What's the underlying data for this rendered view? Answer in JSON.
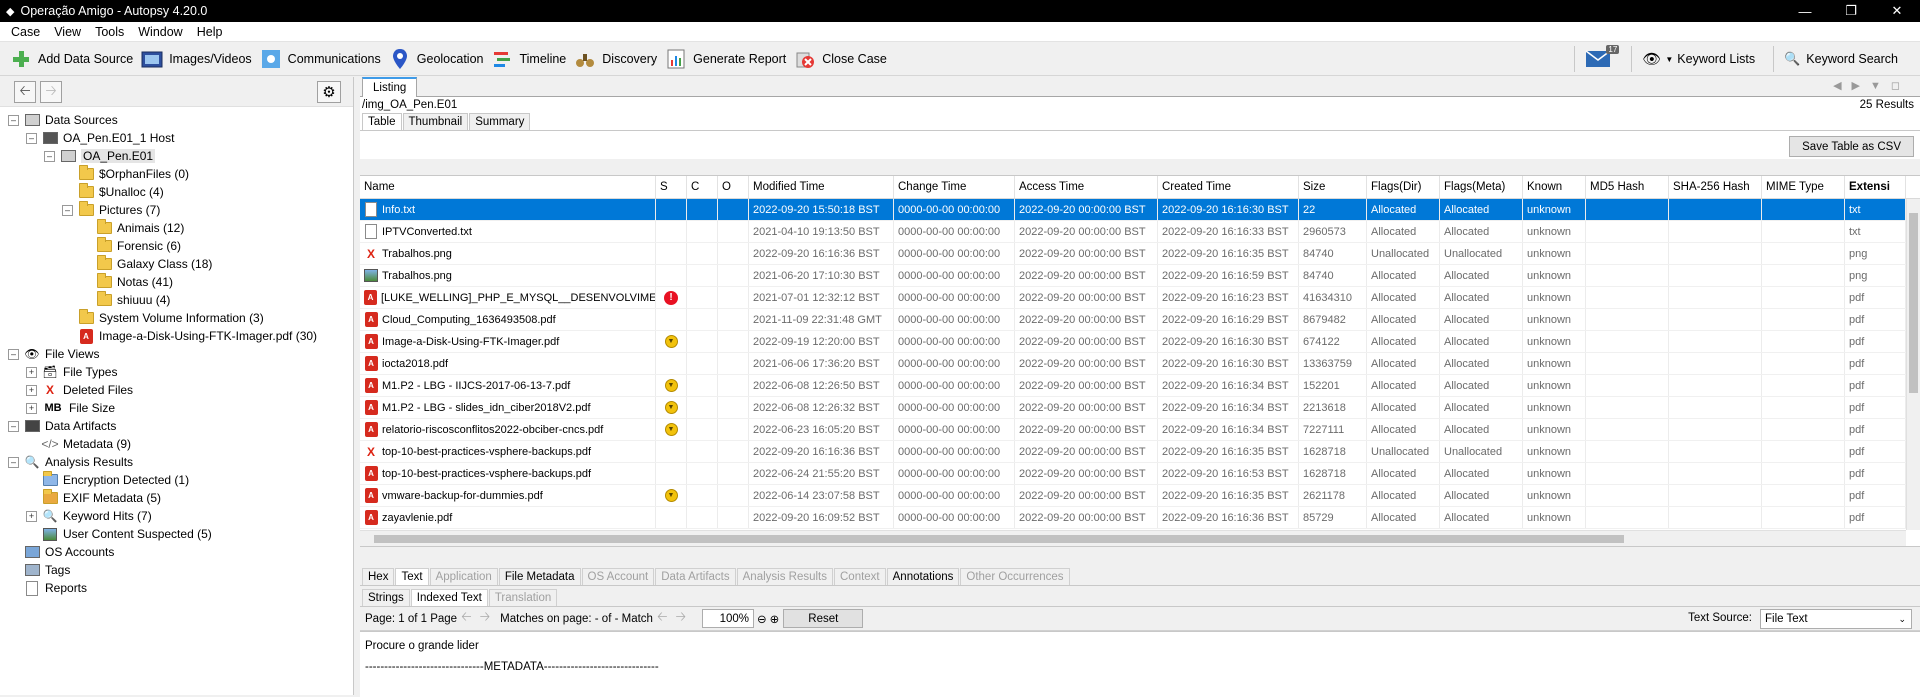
{
  "window": {
    "title": "Operação Amigo - Autopsy 4.20.0"
  },
  "menu": [
    "Case",
    "View",
    "Tools",
    "Window",
    "Help"
  ],
  "toolbar": {
    "add_data_source": "Add Data Source",
    "images_videos": "Images/Videos",
    "communications": "Communications",
    "geolocation": "Geolocation",
    "timeline": "Timeline",
    "discovery": "Discovery",
    "generate_report": "Generate Report",
    "close_case": "Close Case",
    "mail_badge": "17",
    "keyword_lists": "Keyword Lists",
    "keyword_search": "Keyword Search"
  },
  "tree": {
    "data_sources": "Data Sources",
    "host": "OA_Pen.E01_1 Host",
    "image": "OA_Pen.E01",
    "orphan": "$OrphanFiles (0)",
    "unalloc": "$Unalloc (4)",
    "pictures": "Pictures (7)",
    "animais": "Animais (12)",
    "forensic": "Forensic (6)",
    "galaxy": "Galaxy Class (18)",
    "notas": "Notas (41)",
    "shiuuu": "shiuuu (4)",
    "svi": "System Volume Information (3)",
    "imagepdf": "Image-a-Disk-Using-FTK-Imager.pdf (30)",
    "file_views": "File Views",
    "file_types": "File Types",
    "deleted_files": "Deleted Files",
    "file_size": "File Size",
    "data_artifacts": "Data Artifacts",
    "metadata": "Metadata (9)",
    "analysis_results": "Analysis Results",
    "encryption": "Encryption Detected (1)",
    "exif": "EXIF Metadata (5)",
    "keyword_hits": "Keyword Hits (7)",
    "user_content": "User Content Suspected (5)",
    "os_accounts": "OS Accounts",
    "tags": "Tags",
    "reports": "Reports"
  },
  "listing": {
    "tab": "Listing",
    "path": "/img_OA_Pen.E01",
    "count": "25  Results",
    "subtabs": [
      "Table",
      "Thumbnail",
      "Summary"
    ],
    "save_csv": "Save Table as CSV",
    "columns": [
      "Name",
      "S",
      "C",
      "O",
      "Modified Time",
      "Change Time",
      "Access Time",
      "Created Time",
      "Size",
      "Flags(Dir)",
      "Flags(Meta)",
      "Known",
      "MD5 Hash",
      "SHA-256 Hash",
      "MIME Type",
      "Extensi"
    ],
    "rows": [
      {
        "icon": "doc",
        "flag": "",
        "name": "Info.txt",
        "mod": "2022-09-20 15:50:18 BST",
        "chg": "0000-00-00 00:00:00",
        "acc": "2022-09-20 00:00:00 BST",
        "cre": "2022-09-20 16:16:30 BST",
        "size": "22",
        "fdir": "Allocated",
        "fmeta": "Allocated",
        "known": "unknown",
        "ext": "txt"
      },
      {
        "icon": "doc",
        "flag": "",
        "name": "IPTVConverted.txt",
        "mod": "2021-04-10 19:13:50 BST",
        "chg": "0000-00-00 00:00:00",
        "acc": "2022-09-20 00:00:00 BST",
        "cre": "2022-09-20 16:16:33 BST",
        "size": "2960573",
        "fdir": "Allocated",
        "fmeta": "Allocated",
        "known": "unknown",
        "ext": "txt"
      },
      {
        "icon": "x",
        "flag": "",
        "name": "Trabalhos.png",
        "mod": "2022-09-20 16:16:36 BST",
        "chg": "0000-00-00 00:00:00",
        "acc": "2022-09-20 00:00:00 BST",
        "cre": "2022-09-20 16:16:35 BST",
        "size": "84740",
        "fdir": "Unallocated",
        "fmeta": "Unallocated",
        "known": "unknown",
        "ext": "png"
      },
      {
        "icon": "img",
        "flag": "",
        "name": "Trabalhos.png",
        "mod": "2021-06-20 17:10:30 BST",
        "chg": "0000-00-00 00:00:00",
        "acc": "2022-09-20 00:00:00 BST",
        "cre": "2022-09-20 16:16:59 BST",
        "size": "84740",
        "fdir": "Allocated",
        "fmeta": "Allocated",
        "known": "unknown",
        "ext": "png"
      },
      {
        "icon": "pdf",
        "flag": "err",
        "name": "[LUKE_WELLING]_PHP_E_MYSQL__DESENVOLVIMENTO_",
        "mod": "2021-07-01 12:32:12 BST",
        "chg": "0000-00-00 00:00:00",
        "acc": "2022-09-20 00:00:00 BST",
        "cre": "2022-09-20 16:16:23 BST",
        "size": "41634310",
        "fdir": "Allocated",
        "fmeta": "Allocated",
        "known": "unknown",
        "ext": "pdf"
      },
      {
        "icon": "pdf",
        "flag": "",
        "name": "Cloud_Computing_1636493508.pdf",
        "mod": "2021-11-09 22:31:48 GMT",
        "chg": "0000-00-00 00:00:00",
        "acc": "2022-09-20 00:00:00 BST",
        "cre": "2022-09-20 16:16:29 BST",
        "size": "8679482",
        "fdir": "Allocated",
        "fmeta": "Allocated",
        "known": "unknown",
        "ext": "pdf"
      },
      {
        "icon": "pdf",
        "flag": "warn",
        "name": "Image-a-Disk-Using-FTK-Imager.pdf",
        "mod": "2022-09-19 12:20:00 BST",
        "chg": "0000-00-00 00:00:00",
        "acc": "2022-09-20 00:00:00 BST",
        "cre": "2022-09-20 16:16:30 BST",
        "size": "674122",
        "fdir": "Allocated",
        "fmeta": "Allocated",
        "known": "unknown",
        "ext": "pdf"
      },
      {
        "icon": "pdf",
        "flag": "",
        "name": "iocta2018.pdf",
        "mod": "2021-06-06 17:36:20 BST",
        "chg": "0000-00-00 00:00:00",
        "acc": "2022-09-20 00:00:00 BST",
        "cre": "2022-09-20 16:16:30 BST",
        "size": "13363759",
        "fdir": "Allocated",
        "fmeta": "Allocated",
        "known": "unknown",
        "ext": "pdf"
      },
      {
        "icon": "pdf",
        "flag": "warn",
        "name": "M1.P2 - LBG - IIJCS-2017-06-13-7.pdf",
        "mod": "2022-06-08 12:26:50 BST",
        "chg": "0000-00-00 00:00:00",
        "acc": "2022-09-20 00:00:00 BST",
        "cre": "2022-09-20 16:16:34 BST",
        "size": "152201",
        "fdir": "Allocated",
        "fmeta": "Allocated",
        "known": "unknown",
        "ext": "pdf"
      },
      {
        "icon": "pdf",
        "flag": "warn",
        "name": "M1.P2 - LBG - slides_idn_ciber2018V2.pdf",
        "mod": "2022-06-08 12:26:32 BST",
        "chg": "0000-00-00 00:00:00",
        "acc": "2022-09-20 00:00:00 BST",
        "cre": "2022-09-20 16:16:34 BST",
        "size": "2213618",
        "fdir": "Allocated",
        "fmeta": "Allocated",
        "known": "unknown",
        "ext": "pdf"
      },
      {
        "icon": "pdf",
        "flag": "warn",
        "name": "relatorio-riscosconflitos2022-obciber-cncs.pdf",
        "mod": "2022-06-23 16:05:20 BST",
        "chg": "0000-00-00 00:00:00",
        "acc": "2022-09-20 00:00:00 BST",
        "cre": "2022-09-20 16:16:34 BST",
        "size": "7227111",
        "fdir": "Allocated",
        "fmeta": "Allocated",
        "known": "unknown",
        "ext": "pdf"
      },
      {
        "icon": "x",
        "flag": "",
        "name": "top-10-best-practices-vsphere-backups.pdf",
        "mod": "2022-09-20 16:16:36 BST",
        "chg": "0000-00-00 00:00:00",
        "acc": "2022-09-20 00:00:00 BST",
        "cre": "2022-09-20 16:16:35 BST",
        "size": "1628718",
        "fdir": "Unallocated",
        "fmeta": "Unallocated",
        "known": "unknown",
        "ext": "pdf"
      },
      {
        "icon": "pdf",
        "flag": "",
        "name": "top-10-best-practices-vsphere-backups.pdf",
        "mod": "2022-06-24 21:55:20 BST",
        "chg": "0000-00-00 00:00:00",
        "acc": "2022-09-20 00:00:00 BST",
        "cre": "2022-09-20 16:16:53 BST",
        "size": "1628718",
        "fdir": "Allocated",
        "fmeta": "Allocated",
        "known": "unknown",
        "ext": "pdf"
      },
      {
        "icon": "pdf",
        "flag": "warn",
        "name": "vmware-backup-for-dummies.pdf",
        "mod": "2022-06-14 23:07:58 BST",
        "chg": "0000-00-00 00:00:00",
        "acc": "2022-09-20 00:00:00 BST",
        "cre": "2022-09-20 16:16:35 BST",
        "size": "2621178",
        "fdir": "Allocated",
        "fmeta": "Allocated",
        "known": "unknown",
        "ext": "pdf"
      },
      {
        "icon": "pdf",
        "flag": "",
        "name": "zayavlenie.pdf",
        "mod": "2022-09-20 16:09:52 BST",
        "chg": "0000-00-00 00:00:00",
        "acc": "2022-09-20 00:00:00 BST",
        "cre": "2022-09-20 16:16:36 BST",
        "size": "85729",
        "fdir": "Allocated",
        "fmeta": "Allocated",
        "known": "unknown",
        "ext": "pdf"
      }
    ]
  },
  "content": {
    "tabs": [
      "Hex",
      "Text",
      "Application",
      "File Metadata",
      "OS Account",
      "Data Artifacts",
      "Analysis Results",
      "Context",
      "Annotations",
      "Other Occurrences"
    ],
    "text_tabs": [
      "Strings",
      "Indexed Text",
      "Translation"
    ],
    "page_label": "Page:  1  of  1  Page",
    "matches_label": "Matches on page:  -  of  -  Match",
    "zoom": "100%",
    "reset": "Reset",
    "text_source_label": "Text Source:",
    "text_source_value": "File Text",
    "line1": "Procure o grande lider",
    "line2": "-------------------------------METADATA------------------------------"
  }
}
